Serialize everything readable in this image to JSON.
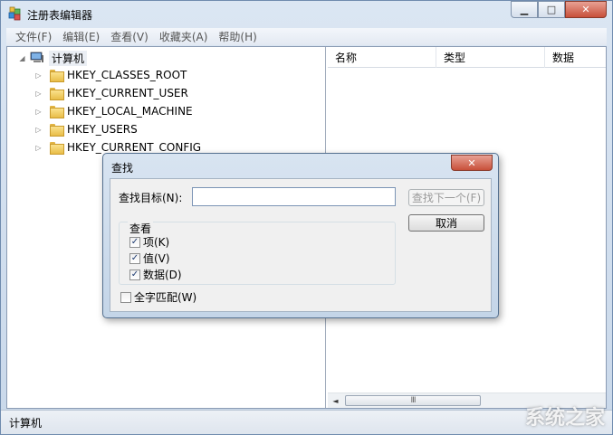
{
  "window": {
    "title": "注册表编辑器",
    "minimize_glyph": "▁",
    "maximize_glyph": "□",
    "close_glyph": "✕"
  },
  "menu": [
    "文件(F)",
    "编辑(E)",
    "查看(V)",
    "收藏夹(A)",
    "帮助(H)"
  ],
  "tree": {
    "root": "计算机",
    "items": [
      "HKEY_CLASSES_ROOT",
      "HKEY_CURRENT_USER",
      "HKEY_LOCAL_MACHINE",
      "HKEY_USERS",
      "HKEY_CURRENT_CONFIG"
    ]
  },
  "list": {
    "columns": [
      "名称",
      "类型",
      "数据"
    ],
    "scroll_left_glyph": "◄",
    "scroll_thumb_glyph": "III"
  },
  "statusbar": {
    "text": "计算机",
    "watermark": "系统之家"
  },
  "dialog": {
    "title": "查找",
    "close_glyph": "✕",
    "find_label": "查找目标(N):",
    "find_value": "",
    "find_next_label": "查找下一个(F)",
    "cancel_label": "取消",
    "look_at_title": "查看",
    "options": [
      {
        "label": "项(K)",
        "checked": true
      },
      {
        "label": "值(V)",
        "checked": true
      },
      {
        "label": "数据(D)",
        "checked": true
      }
    ],
    "match_whole": {
      "label": "全字匹配(W)",
      "checked": false
    }
  }
}
